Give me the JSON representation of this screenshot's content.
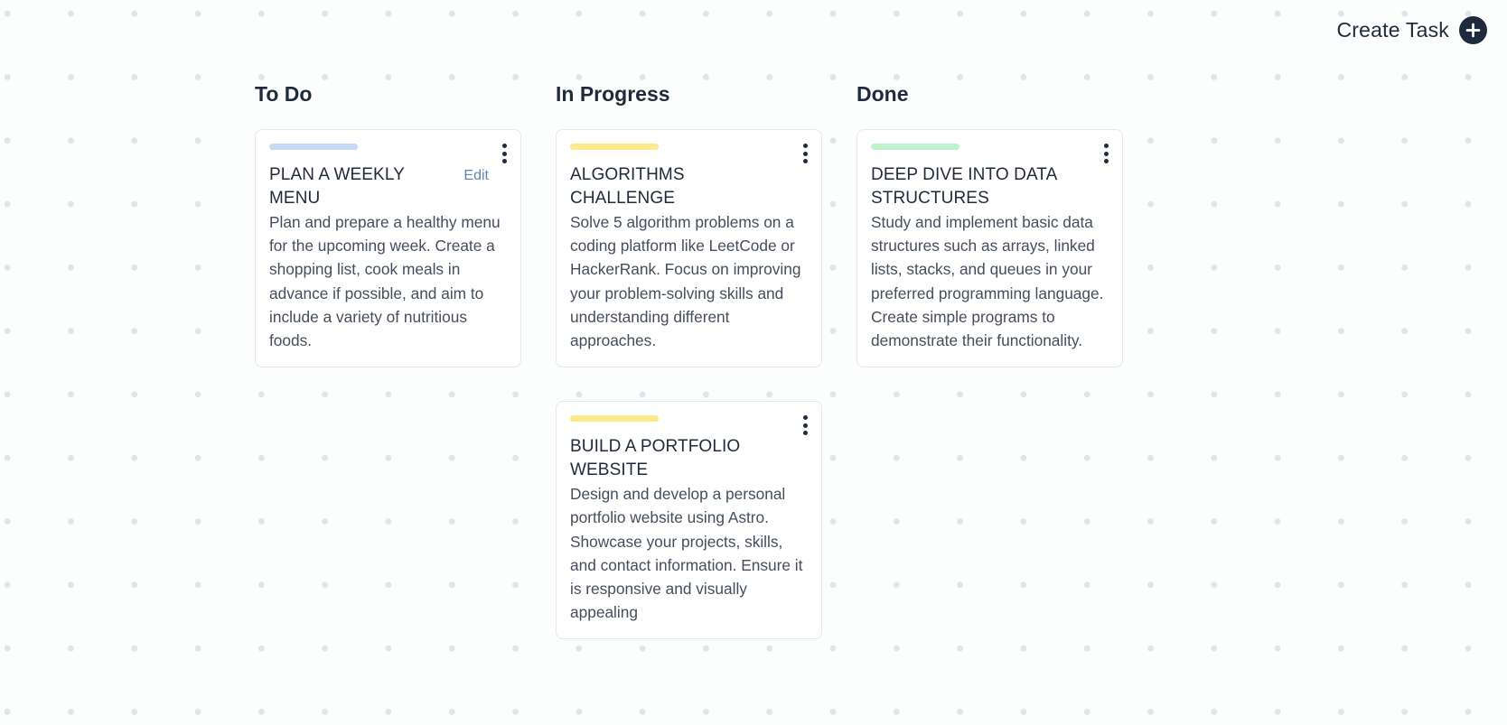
{
  "header": {
    "create_task_label": "Create Task",
    "create_task_icon": "plus-circle-icon"
  },
  "colors": {
    "text_dark": "#1f2a3c",
    "edit_link": "#5a86b5",
    "priority_blue": "#c5dbf5",
    "priority_yellow": "#fbe98a",
    "priority_green": "#bff1cc"
  },
  "columns": [
    {
      "title": "To Do",
      "cards": [
        {
          "title": "PLAN A WEEKLY MENU",
          "edit_label": "Edit",
          "priority_color": "#c5dbf5",
          "description": "Plan and prepare a healthy menu for the upcoming week. Create a shopping list, cook meals in advance if possible, and aim to include a variety of nutritious foods."
        }
      ]
    },
    {
      "title": "In Progress",
      "cards": [
        {
          "title": "ALGORITHMS CHALLENGE",
          "priority_color": "#fbe98a",
          "description": "Solve 5 algorithm problems on a coding platform like LeetCode or HackerRank. Focus on improving your problem-solving skills and understanding different approaches."
        },
        {
          "title": "BUILD A PORTFOLIO WEBSITE",
          "priority_color": "#fbe98a",
          "description": "Design and develop a personal portfolio website using Astro. Showcase your projects, skills, and contact information. Ensure it is responsive and visually appealing"
        }
      ]
    },
    {
      "title": "Done",
      "cards": [
        {
          "title": "DEEP DIVE INTO DATA STRUCTURES",
          "priority_color": "#bff1cc",
          "description": "Study and implement basic data structures such as arrays, linked lists, stacks, and queues in your preferred programming language. Create simple programs to demonstrate their functionality."
        }
      ]
    }
  ]
}
